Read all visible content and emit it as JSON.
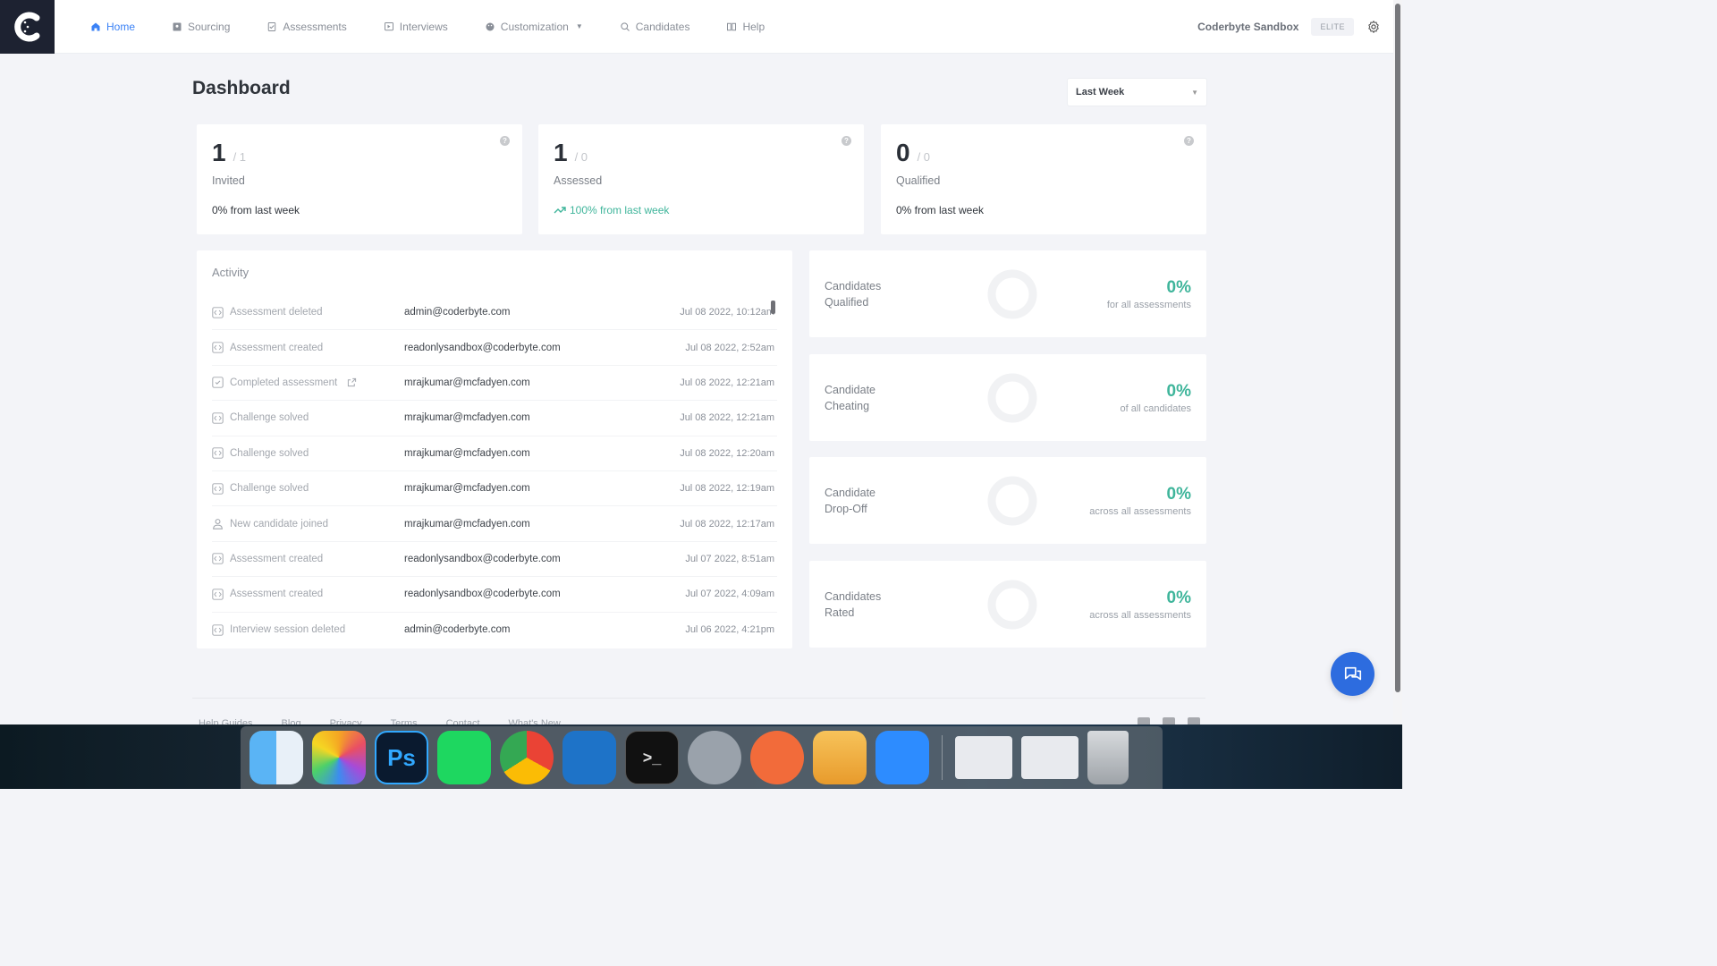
{
  "nav": {
    "items": [
      {
        "label": "Home",
        "icon": "home-icon",
        "active": true
      },
      {
        "label": "Sourcing",
        "icon": "id-card-icon"
      },
      {
        "label": "Assessments",
        "icon": "assessment-icon"
      },
      {
        "label": "Interviews",
        "icon": "video-icon"
      },
      {
        "label": "Customization",
        "icon": "palette-icon",
        "has_dropdown": true
      },
      {
        "label": "Candidates",
        "icon": "search-icon"
      },
      {
        "label": "Help",
        "icon": "book-icon"
      }
    ],
    "org_name": "Coderbyte Sandbox",
    "plan_badge": "ELITE"
  },
  "page": {
    "title": "Dashboard",
    "range_select": {
      "selected": "Last Week"
    }
  },
  "stats": [
    {
      "value": "1",
      "total": "/ 1",
      "label": "Invited",
      "delta": "0% from last week",
      "trend": "flat"
    },
    {
      "value": "1",
      "total": "/ 0",
      "label": "Assessed",
      "delta": "100% from last week",
      "trend": "up"
    },
    {
      "value": "0",
      "total": "/ 0",
      "label": "Qualified",
      "delta": "0% from last week",
      "trend": "flat"
    }
  ],
  "activity": {
    "title": "Activity",
    "rows": [
      {
        "event": "Assessment deleted",
        "icon": "code-icon",
        "user": "admin@coderbyte.com",
        "time": "Jul 08 2022, 10:12am"
      },
      {
        "event": "Assessment created",
        "icon": "code-icon",
        "user": "readonlysandbox@coderbyte.com",
        "time": "Jul 08 2022, 2:52am"
      },
      {
        "event": "Completed assessment",
        "icon": "checkbox-icon",
        "external_link": true,
        "user": "mrajkumar@mcfadyen.com",
        "time": "Jul 08 2022, 12:21am"
      },
      {
        "event": "Challenge solved",
        "icon": "code-icon",
        "user": "mrajkumar@mcfadyen.com",
        "time": "Jul 08 2022, 12:21am"
      },
      {
        "event": "Challenge solved",
        "icon": "code-icon",
        "user": "mrajkumar@mcfadyen.com",
        "time": "Jul 08 2022, 12:20am"
      },
      {
        "event": "Challenge solved",
        "icon": "code-icon",
        "user": "mrajkumar@mcfadyen.com",
        "time": "Jul 08 2022, 12:19am"
      },
      {
        "event": "New candidate joined",
        "icon": "user-icon",
        "user": "mrajkumar@mcfadyen.com",
        "time": "Jul 08 2022, 12:17am"
      },
      {
        "event": "Assessment created",
        "icon": "code-icon",
        "user": "readonlysandbox@coderbyte.com",
        "time": "Jul 07 2022, 8:51am"
      },
      {
        "event": "Assessment created",
        "icon": "code-icon",
        "user": "readonlysandbox@coderbyte.com",
        "time": "Jul 07 2022, 4:09am"
      },
      {
        "event": "Interview session deleted",
        "icon": "code-icon",
        "user": "admin@coderbyte.com",
        "time": "Jul 06 2022, 4:21pm"
      }
    ]
  },
  "metrics": [
    {
      "title": "Candidates\nQualified",
      "percent_label": "0%",
      "percent": 0,
      "subtitle": "for all assessments"
    },
    {
      "title": "Candidate\nCheating",
      "percent_label": "0%",
      "percent": 0,
      "subtitle": "of all candidates"
    },
    {
      "title": "Candidate\nDrop-Off",
      "percent_label": "0%",
      "percent": 0,
      "subtitle": "across all assessments"
    },
    {
      "title": "Candidates\nRated",
      "percent_label": "0%",
      "percent": 0,
      "subtitle": "across all assessments"
    }
  ],
  "footer": {
    "links": [
      "Help Guides",
      "Blog",
      "Privacy",
      "Terms",
      "Contact",
      "What's New"
    ],
    "socials": [
      "facebook-icon",
      "twitter-icon",
      "linkedin-icon"
    ]
  },
  "colors": {
    "accent": "#3b82f6",
    "positive": "#3fb59b",
    "logo_bg": "#1d2231",
    "chat": "#2d6cdf"
  },
  "dock": {
    "apps": [
      {
        "name": "Finder",
        "glyph": ""
      },
      {
        "name": "Photos",
        "glyph": ""
      },
      {
        "name": "Photoshop",
        "glyph": "Ps"
      },
      {
        "name": "Spotify",
        "glyph": ""
      },
      {
        "name": "Chrome",
        "glyph": ""
      },
      {
        "name": "VS Code",
        "glyph": ""
      },
      {
        "name": "Terminal",
        "glyph": ">_"
      },
      {
        "name": "System Preferences",
        "glyph": ""
      },
      {
        "name": "Postman",
        "glyph": ""
      },
      {
        "name": "TablePlus",
        "glyph": ""
      },
      {
        "name": "Zoom",
        "glyph": ""
      }
    ]
  }
}
